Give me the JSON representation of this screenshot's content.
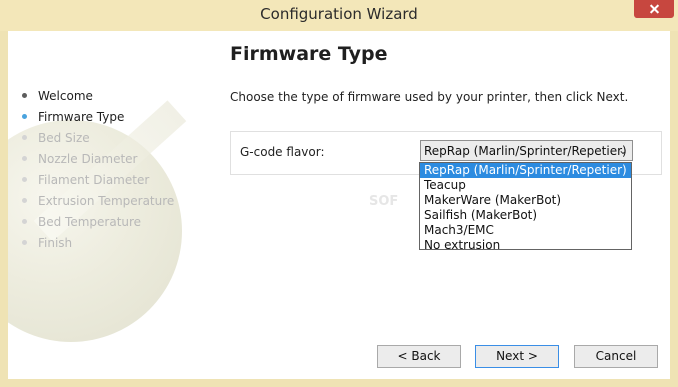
{
  "window": {
    "title": "Configuration Wizard"
  },
  "page": {
    "heading": "Firmware Type",
    "instruction": "Choose the type of firmware used by your printer, then click Next."
  },
  "steps": [
    {
      "label": "Welcome",
      "state": "done"
    },
    {
      "label": "Firmware Type",
      "state": "current"
    },
    {
      "label": "Bed Size",
      "state": "pending"
    },
    {
      "label": "Nozzle Diameter",
      "state": "pending"
    },
    {
      "label": "Filament Diameter",
      "state": "pending"
    },
    {
      "label": "Extrusion Temperature",
      "state": "pending"
    },
    {
      "label": "Bed Temperature",
      "state": "pending"
    },
    {
      "label": "Finish",
      "state": "pending"
    }
  ],
  "form": {
    "label": "G-code flavor:",
    "selected": "RepRap (Marlin/Sprinter/Repetier)",
    "options": [
      "RepRap (Marlin/Sprinter/Repetier)",
      "Teacup",
      "MakerWare (MakerBot)",
      "Sailfish (MakerBot)",
      "Mach3/EMC",
      "No extrusion"
    ]
  },
  "buttons": {
    "back": "< Back",
    "next": "Next >",
    "cancel": "Cancel"
  },
  "watermark": "SOF"
}
